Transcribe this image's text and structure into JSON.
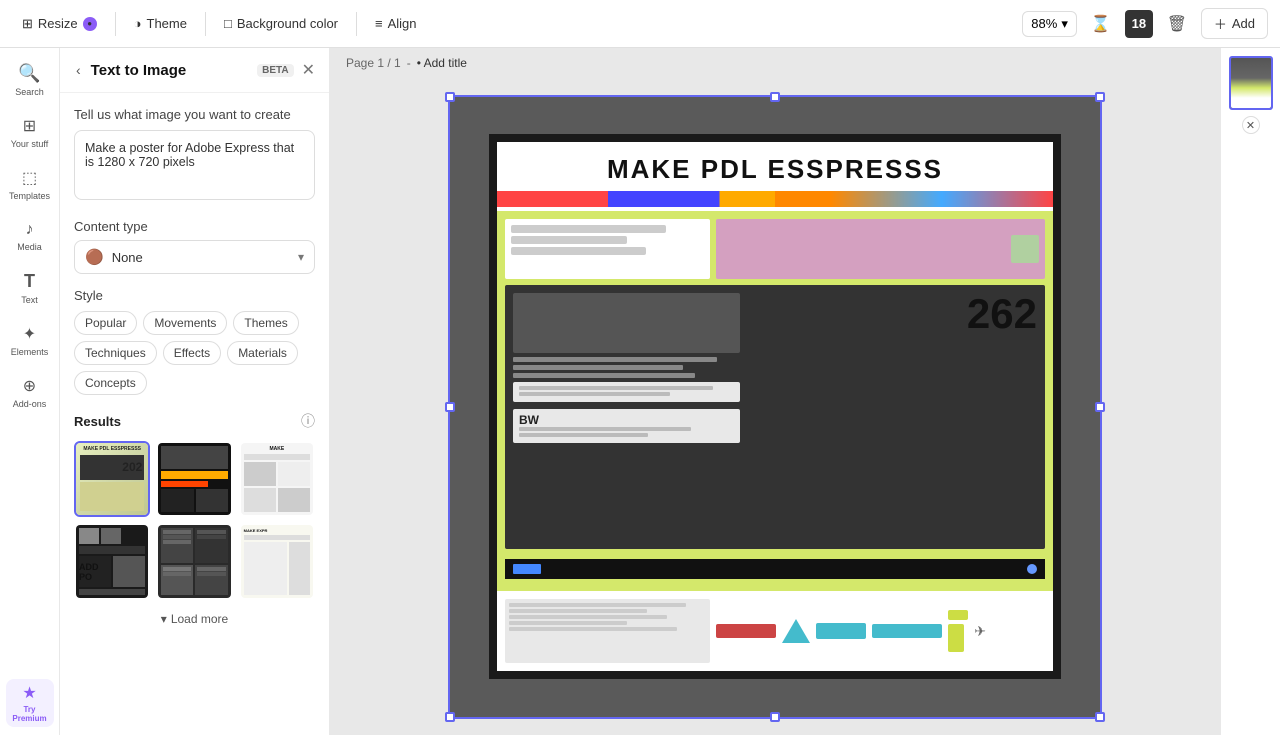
{
  "toolbar": {
    "resize_label": "Resize",
    "theme_label": "Theme",
    "bg_color_label": "Background color",
    "align_label": "Align",
    "zoom": "88%",
    "add_label": "Add"
  },
  "sidebar": {
    "items": [
      {
        "id": "search",
        "icon": "🔍",
        "label": "Search"
      },
      {
        "id": "your-stuff",
        "icon": "⊞",
        "label": "Your stuff"
      },
      {
        "id": "templates",
        "icon": "⊟",
        "label": "Templates"
      },
      {
        "id": "media",
        "icon": "🎵",
        "label": "Media"
      },
      {
        "id": "text",
        "icon": "T",
        "label": "Text"
      },
      {
        "id": "elements",
        "icon": "✦",
        "label": "Elements"
      },
      {
        "id": "add-ons",
        "icon": "⊕",
        "label": "Add-ons"
      },
      {
        "id": "try-premium",
        "icon": "★",
        "label": "Try Premium"
      }
    ]
  },
  "panel": {
    "back_label": "‹",
    "title": "Text to Image",
    "beta_label": "BETA",
    "close_label": "✕",
    "prompt_label": "Tell us what image you want to create",
    "prompt_value": "Make a poster for Adobe Express that is 1280 x 720 pixels",
    "content_type_label": "Content type",
    "content_type_value": "None",
    "style_label": "Style",
    "style_tags": [
      "Popular",
      "Movements",
      "Themes",
      "Techniques",
      "Effects",
      "Materials",
      "Concepts"
    ],
    "results_label": "Results",
    "load_more_label": "Load more"
  },
  "canvas": {
    "page_info": "Page 1 / 1",
    "add_title": "• Add title",
    "poster_title": "MAKE PDL ESSPRESSS",
    "poster_number": "262",
    "page_label": "Page 1"
  }
}
